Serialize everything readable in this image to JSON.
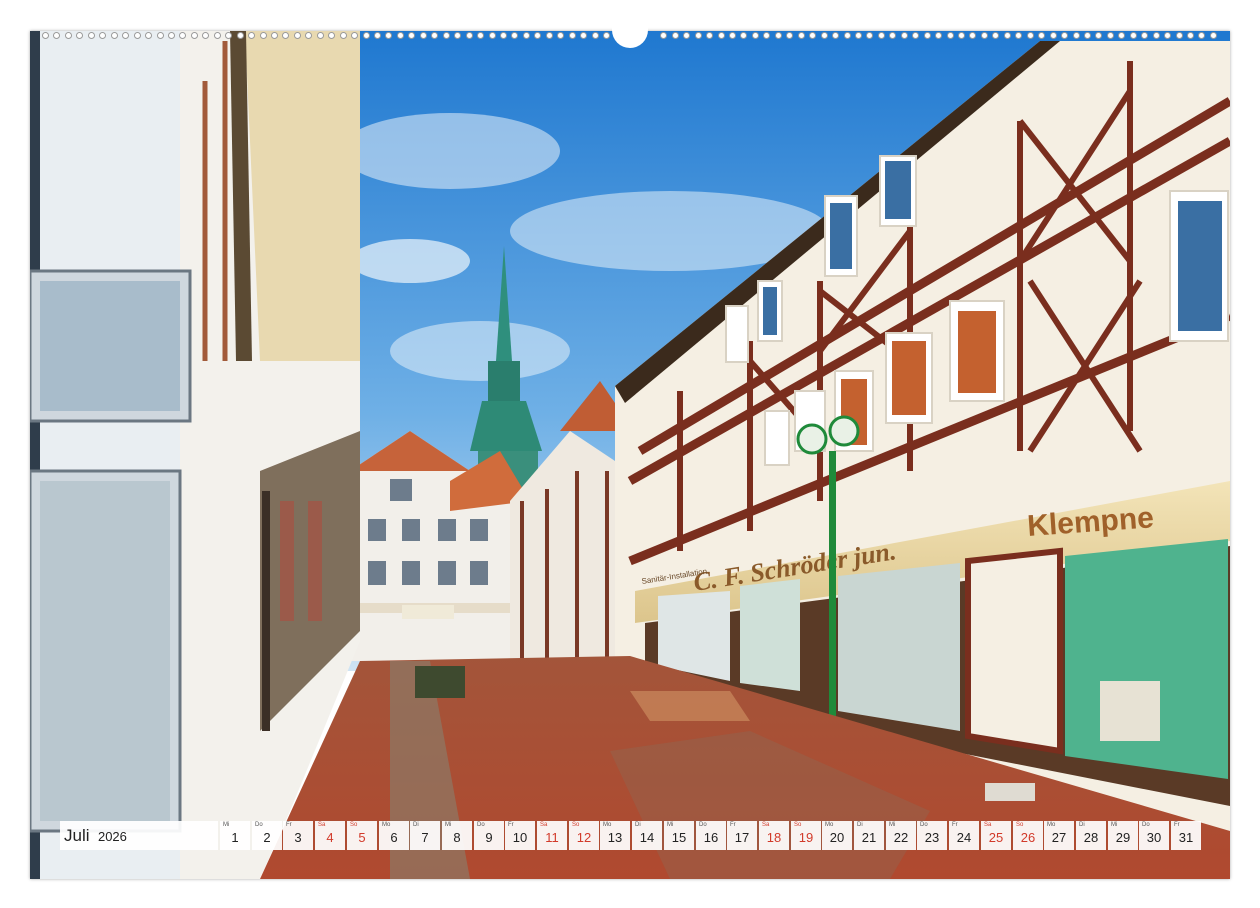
{
  "calendar": {
    "month": "Juli",
    "year": "2026",
    "weekend_color": "#d23a2a",
    "days": [
      {
        "wd": "Mi",
        "num": "1",
        "weekend": false
      },
      {
        "wd": "Do",
        "num": "2",
        "weekend": false
      },
      {
        "wd": "Fr",
        "num": "3",
        "weekend": false
      },
      {
        "wd": "Sa",
        "num": "4",
        "weekend": true
      },
      {
        "wd": "So",
        "num": "5",
        "weekend": true
      },
      {
        "wd": "Mo",
        "num": "6",
        "weekend": false
      },
      {
        "wd": "Di",
        "num": "7",
        "weekend": false
      },
      {
        "wd": "Mi",
        "num": "8",
        "weekend": false
      },
      {
        "wd": "Do",
        "num": "9",
        "weekend": false
      },
      {
        "wd": "Fr",
        "num": "10",
        "weekend": false
      },
      {
        "wd": "Sa",
        "num": "11",
        "weekend": true
      },
      {
        "wd": "So",
        "num": "12",
        "weekend": true
      },
      {
        "wd": "Mo",
        "num": "13",
        "weekend": false
      },
      {
        "wd": "Di",
        "num": "14",
        "weekend": false
      },
      {
        "wd": "Mi",
        "num": "15",
        "weekend": false
      },
      {
        "wd": "Do",
        "num": "16",
        "weekend": false
      },
      {
        "wd": "Fr",
        "num": "17",
        "weekend": false
      },
      {
        "wd": "Sa",
        "num": "18",
        "weekend": true
      },
      {
        "wd": "So",
        "num": "19",
        "weekend": true
      },
      {
        "wd": "Mo",
        "num": "20",
        "weekend": false
      },
      {
        "wd": "Di",
        "num": "21",
        "weekend": false
      },
      {
        "wd": "Mi",
        "num": "22",
        "weekend": false
      },
      {
        "wd": "Do",
        "num": "23",
        "weekend": false
      },
      {
        "wd": "Fr",
        "num": "24",
        "weekend": false
      },
      {
        "wd": "Sa",
        "num": "25",
        "weekend": true
      },
      {
        "wd": "So",
        "num": "26",
        "weekend": true
      },
      {
        "wd": "Mo",
        "num": "27",
        "weekend": false
      },
      {
        "wd": "Di",
        "num": "28",
        "weekend": false
      },
      {
        "wd": "Mi",
        "num": "29",
        "weekend": false
      },
      {
        "wd": "Do",
        "num": "30",
        "weekend": false
      },
      {
        "wd": "Fr",
        "num": "31",
        "weekend": false
      }
    ]
  },
  "photo": {
    "shop_sign_main": "C. F. Schröder jun.",
    "shop_sign_right": "Klempne",
    "shop_sign_small": "Sanitär-Installation"
  }
}
